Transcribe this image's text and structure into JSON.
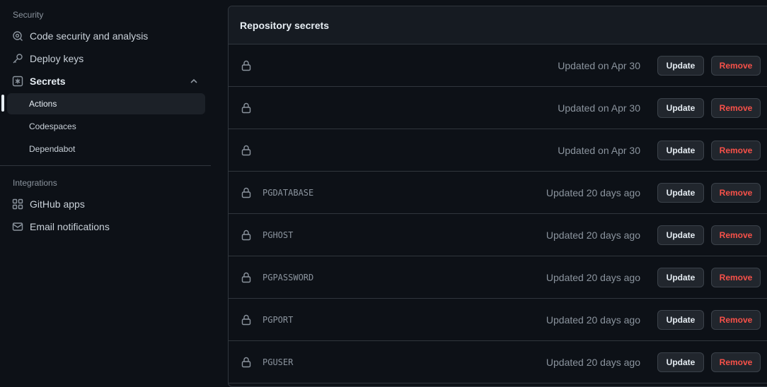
{
  "sidebar": {
    "security_heading": "Security",
    "code_security": "Code security and analysis",
    "deploy_keys": "Deploy keys",
    "secrets": "Secrets",
    "actions": "Actions",
    "codespaces": "Codespaces",
    "dependabot": "Dependabot",
    "integrations_heading": "Integrations",
    "github_apps": "GitHub apps",
    "email_notifications": "Email notifications"
  },
  "panel": {
    "title": "Repository secrets",
    "update_label": "Update",
    "remove_label": "Remove",
    "rows": [
      {
        "name": "",
        "updated": "Updated on Apr 30"
      },
      {
        "name": "",
        "updated": "Updated on Apr 30"
      },
      {
        "name": "",
        "updated": "Updated on Apr 30"
      },
      {
        "name": "PGDATABASE",
        "updated": "Updated 20 days ago"
      },
      {
        "name": "PGHOST",
        "updated": "Updated 20 days ago"
      },
      {
        "name": "PGPASSWORD",
        "updated": "Updated 20 days ago"
      },
      {
        "name": "PGPORT",
        "updated": "Updated 20 days ago"
      },
      {
        "name": "PGUSER",
        "updated": "Updated 20 days ago"
      }
    ]
  },
  "colors": {
    "background": "#0d1117",
    "header": "#161b22",
    "border": "#30363d",
    "danger": "#f85149"
  }
}
